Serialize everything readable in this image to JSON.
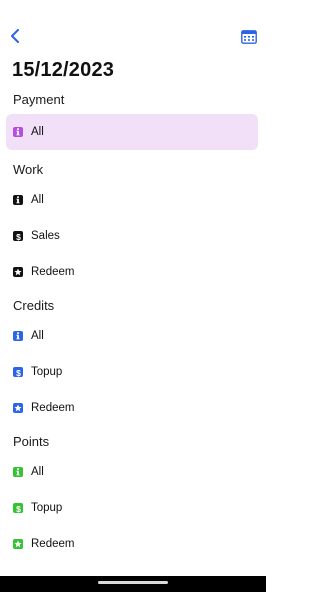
{
  "header": {
    "title": "15/12/2023",
    "back_icon": "chevron-left-icon",
    "calendar_icon": "calendar-icon",
    "accent_color": "#2b63e9"
  },
  "sections": [
    {
      "title": "Payment",
      "color": "#b54de2",
      "items": [
        {
          "label": "All",
          "icon": "info-icon",
          "active": true
        }
      ]
    },
    {
      "title": "Work",
      "color": "#111111",
      "items": [
        {
          "label": "All",
          "icon": "info-icon"
        },
        {
          "label": "Sales",
          "icon": "dollar-icon"
        },
        {
          "label": "Redeem",
          "icon": "star-icon"
        }
      ]
    },
    {
      "title": "Credits",
      "color": "#2b63e9",
      "items": [
        {
          "label": "All",
          "icon": "info-icon"
        },
        {
          "label": "Topup",
          "icon": "dollar-icon"
        },
        {
          "label": "Redeem",
          "icon": "star-icon"
        }
      ]
    },
    {
      "title": "Points",
      "color": "#35c235",
      "items": [
        {
          "label": "All",
          "icon": "info-icon"
        },
        {
          "label": "Topup",
          "icon": "dollar-icon"
        },
        {
          "label": "Redeem",
          "icon": "star-icon"
        }
      ]
    }
  ],
  "active_highlight_color": "#f2dff8"
}
